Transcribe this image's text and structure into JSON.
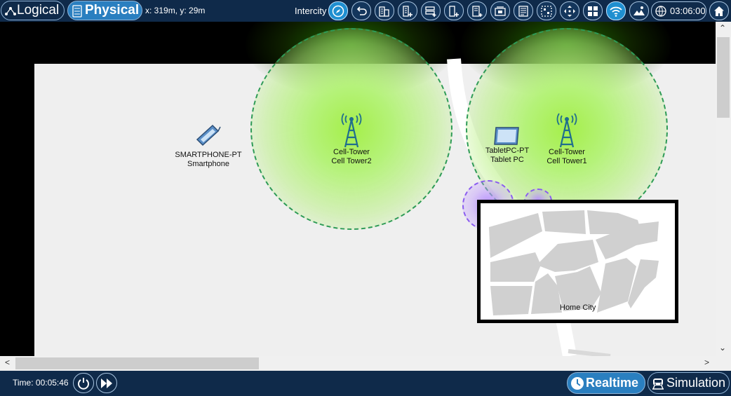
{
  "topbar": {
    "logical_label": "Logical",
    "physical_label": "Physical",
    "coordinates": "x: 319m, y: 29m",
    "location": "Intercity",
    "clock": "03:06:00",
    "tool_icons": [
      "navigation-icon",
      "back-icon",
      "new-building-icon",
      "new-city-icon",
      "new-rack-icon",
      "new-closet-icon",
      "move-object-icon",
      "set-background-icon",
      "edit-grid-icon",
      "cluster-icon",
      "move-icon",
      "grid-icon",
      "wireless-icon",
      "background-image-icon",
      "time-zone-icon",
      "home-icon"
    ]
  },
  "map": {
    "towers": [
      {
        "type": "Cell-Tower",
        "name": "Cell Tower2"
      },
      {
        "type": "Cell-Tower",
        "name": "Cell Tower1"
      }
    ],
    "devices": [
      {
        "type": "SMARTPHONE-PT",
        "name": "Smartphone"
      },
      {
        "type": "TabletPC-PT",
        "name": "Tablet PC"
      }
    ],
    "city_name": "Home City"
  },
  "bottombar": {
    "time_label": "Time: 00:05:46",
    "realtime_label": "Realtime",
    "simulation_label": "Simulation"
  },
  "colors": {
    "bar_background": "#0f2a4a",
    "active_tab": "#2a7fc0",
    "range_fill": "#a5ef4a",
    "range_border": "#2e9b56"
  }
}
